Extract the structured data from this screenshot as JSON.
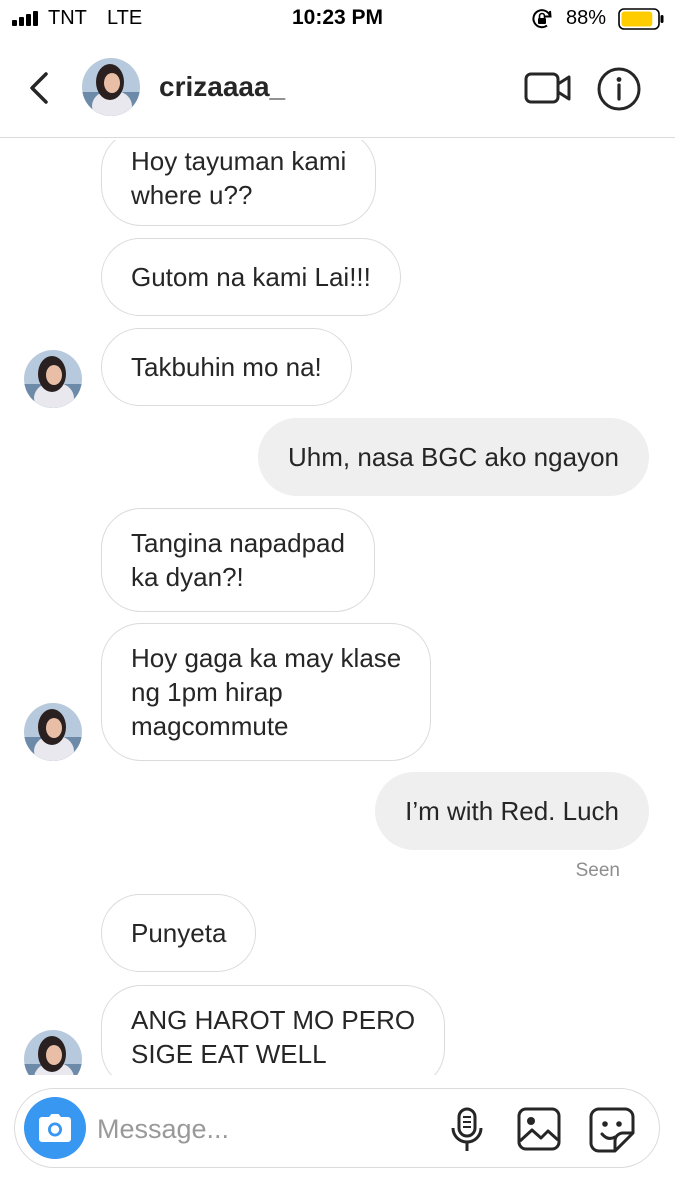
{
  "status_bar": {
    "carrier": "TNT",
    "network": "LTE",
    "time": "10:23 PM",
    "battery_percent": "88%",
    "battery_level": 0.88,
    "battery_color": "#ffcc00",
    "icons": [
      "signal-icon",
      "orientation-lock-icon",
      "battery-icon"
    ]
  },
  "header": {
    "username": "crizaaaa_",
    "icons": [
      "back-icon",
      "avatar",
      "video-call-icon",
      "info-icon"
    ]
  },
  "messages": [
    {
      "side": "in",
      "lines": [
        "Hoy tayuman kami",
        "where u??"
      ]
    },
    {
      "side": "in",
      "lines": [
        "Gutom na kami Lai!!!"
      ]
    },
    {
      "side": "in",
      "lines": [
        "Takbuhin mo na!"
      ]
    },
    {
      "side": "out",
      "lines": [
        "Uhm, nasa BGC ako ngayon"
      ]
    },
    {
      "side": "in",
      "lines": [
        "Tangina napadpad",
        "ka dyan?!"
      ]
    },
    {
      "side": "in",
      "lines": [
        "Hoy gaga ka may klase",
        "ng 1pm hirap",
        "magcommute"
      ]
    },
    {
      "side": "out",
      "lines": [
        "I’m with Red. Luch"
      ]
    },
    {
      "side": "in",
      "lines": [
        "Punyeta"
      ]
    },
    {
      "side": "in",
      "lines": [
        "ANG HAROT MO PERO",
        "SIGE EAT WELL"
      ]
    }
  ],
  "seen_label": "Seen",
  "composer": {
    "placeholder": "Message...",
    "icons": [
      "camera-icon",
      "microphone-icon",
      "gallery-icon",
      "sticker-icon"
    ]
  },
  "colors": {
    "accent": "#3897f0",
    "incoming_border": "#dbdbdb",
    "outgoing_bg": "#efefef",
    "muted_text": "#8e8e8e"
  }
}
